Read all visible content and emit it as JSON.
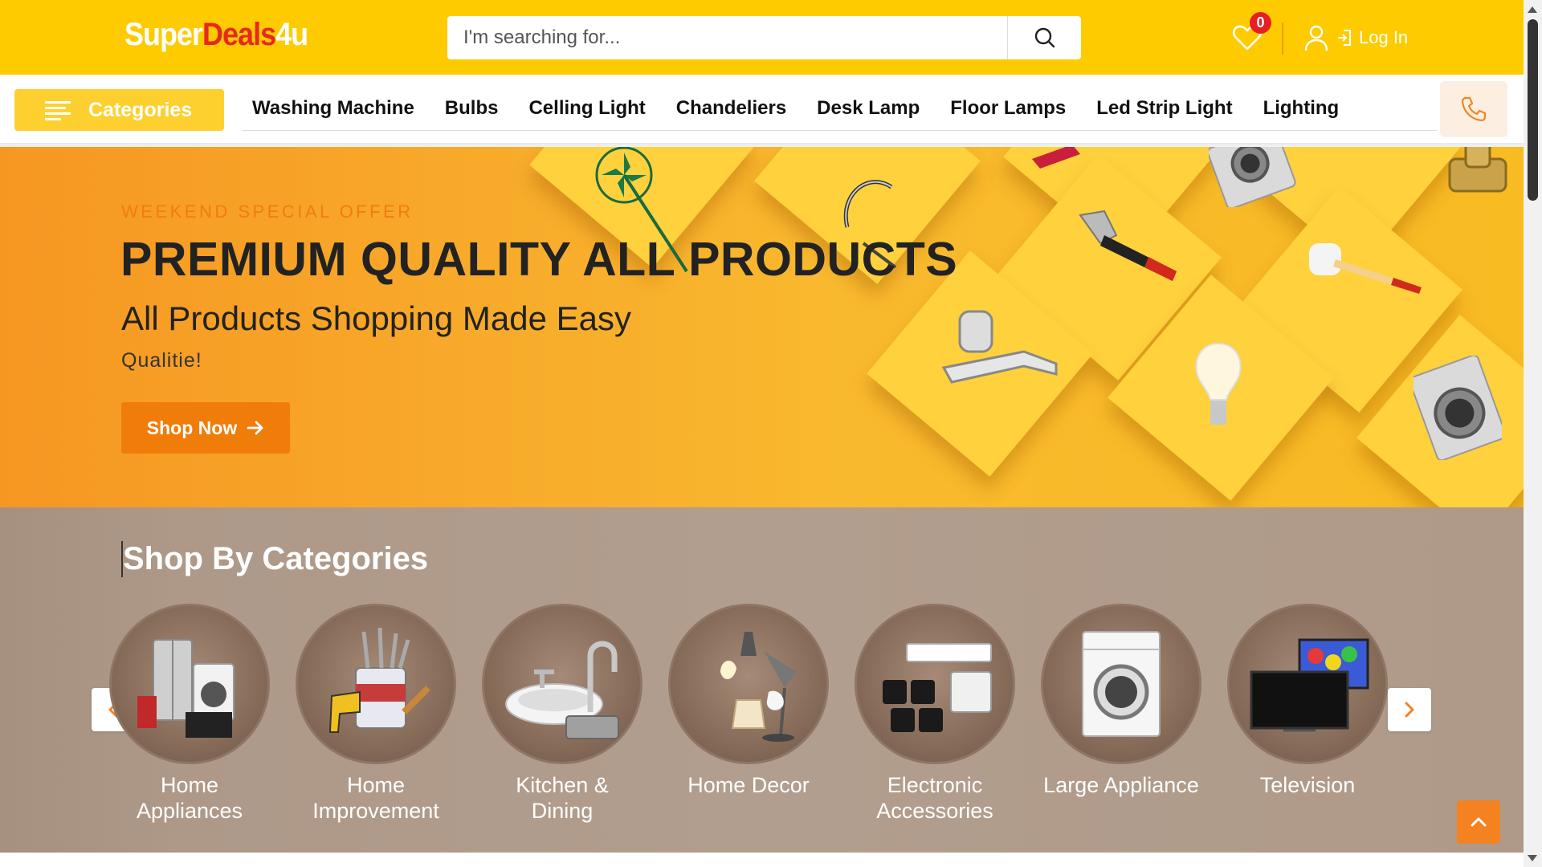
{
  "header": {
    "logo": {
      "part1": "Super",
      "part2": "Deals",
      "part3": "4u"
    },
    "search": {
      "placeholder": "I'm searching for...",
      "icon": "search-icon"
    },
    "wishlist": {
      "count": "0",
      "icon": "heart-icon"
    },
    "login": {
      "label": "Log In",
      "icon": "user-icon"
    }
  },
  "nav": {
    "categories_label": "Categories",
    "links": [
      "Washing Machine",
      "Bulbs",
      "Celling Light",
      "Chandeliers",
      "Desk Lamp",
      "Floor Lamps",
      "Led Strip Light",
      "Lighting"
    ],
    "phone_icon": "phone-icon"
  },
  "hero": {
    "tagline": "WEEKEND SPECIAL OFFER",
    "title": "PREMIUM QUALITY ALL PRODUCTS",
    "subtitle": "All Products Shopping Made Easy",
    "small": "Qualitie!",
    "button": "Shop Now"
  },
  "categories": {
    "title": "Shop By Categories",
    "items": [
      {
        "line1": "Home",
        "line2": "Appliances"
      },
      {
        "line1": "Home",
        "line2": "Improvement"
      },
      {
        "line1": "Kitchen &",
        "line2": "Dining"
      },
      {
        "line1": "Home Decor",
        "line2": ""
      },
      {
        "line1": "Electronic",
        "line2": "Accessories"
      },
      {
        "line1": "Large Appliance",
        "line2": ""
      },
      {
        "line1": "Television",
        "line2": ""
      }
    ]
  },
  "colors": {
    "brand_yellow": "#fecb00",
    "accent_orange": "#f07d0a",
    "logo_red": "#e8281e",
    "badge_red": "#e81e25"
  }
}
